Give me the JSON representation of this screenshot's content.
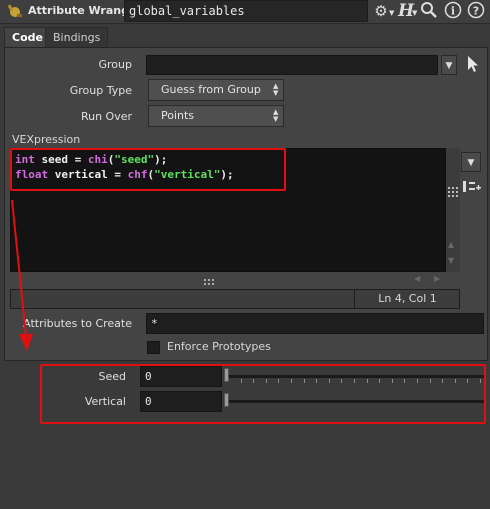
{
  "titlebar": {
    "node_type": "Attribute Wrangle",
    "node_name": "global_variables",
    "icons": [
      "wrangle-node-icon",
      "gear-icon",
      "help-h-icon",
      "search-icon",
      "info-icon",
      "question-icon"
    ]
  },
  "tabs": [
    {
      "label": "Code",
      "active": true
    },
    {
      "label": "Bindings",
      "active": false
    }
  ],
  "parms": {
    "group_label": "Group",
    "group_value": "",
    "group_type_label": "Group Type",
    "group_type_value": "Guess from Group",
    "run_over_label": "Run Over",
    "run_over_value": "Points",
    "vexpression_label": "VEXpression",
    "code_lines": [
      [
        {
          "t": "int",
          "c": "kw"
        },
        {
          "t": " seed = ",
          "c": "txt"
        },
        {
          "t": "chi",
          "c": "fn"
        },
        {
          "t": "(",
          "c": "txt"
        },
        {
          "t": "\"seed\"",
          "c": "str"
        },
        {
          "t": ");",
          "c": "txt"
        }
      ],
      [
        {
          "t": "float",
          "c": "kw"
        },
        {
          "t": " vertical = ",
          "c": "txt"
        },
        {
          "t": "chf",
          "c": "fn"
        },
        {
          "t": "(",
          "c": "txt"
        },
        {
          "t": "\"vertical\"",
          "c": "str"
        },
        {
          "t": ");",
          "c": "txt"
        }
      ]
    ],
    "status_position": "Ln 4, Col 1",
    "attrs_to_create_label": "Attributes to Create",
    "attrs_to_create_value": "*",
    "enforce_prototypes_label": "Enforce Prototypes"
  },
  "spare_parms": {
    "seed_label": "Seed",
    "seed_value": "0",
    "vertical_label": "Vertical",
    "vertical_value": "0"
  },
  "colors": {
    "annotation": "#e01010",
    "keyword": "#d36be0",
    "string": "#5fe05f"
  }
}
